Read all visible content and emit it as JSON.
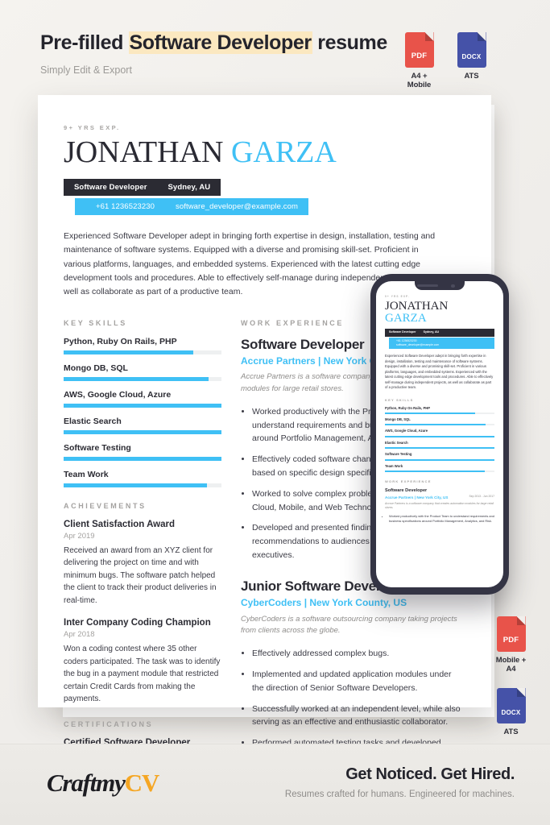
{
  "header": {
    "title_pre": "Pre-filled ",
    "title_hl": "Software Developer",
    "title_post": " resume",
    "subtitle": "Simply Edit & Export"
  },
  "badges_top": [
    {
      "icon": "pdf-file-icon",
      "type": "PDF",
      "label": "A4 + Mobile"
    },
    {
      "icon": "docx-file-icon",
      "type": "DOCX",
      "label": "ATS"
    }
  ],
  "badges_right": [
    {
      "icon": "pdf-file-icon",
      "type": "PDF",
      "label": "Mobile + A4"
    },
    {
      "icon": "docx-file-icon",
      "type": "DOCX",
      "label": "ATS"
    }
  ],
  "resume": {
    "years_exp": "9+ YRS EXP.",
    "first_name": "JONATHAN",
    "last_name": "GARZA",
    "role": "Software Developer",
    "location": "Sydney, AU",
    "phone": "+61 1236523230",
    "email": "software_developer@example.com",
    "summary": "Experienced Software Developer adept in bringing forth expertise in design, installation, testing and maintenance of software systems. Equipped with a diverse and promising skill-set. Proficient in various platforms, languages, and embedded systems. Experienced with the latest cutting edge development tools and procedures. Able to effectively self-manage during independent projects, as well as collaborate as part of a productive team.",
    "skills_heading": "KEY SKILLS",
    "skills": [
      {
        "name": "Python, Ruby On Rails, PHP",
        "level": 82
      },
      {
        "name": "Mongo DB, SQL",
        "level": 92
      },
      {
        "name": "AWS, Google Cloud, Azure",
        "level": 100
      },
      {
        "name": "Elastic Search",
        "level": 100
      },
      {
        "name": "Software Testing",
        "level": 100
      },
      {
        "name": "Team Work",
        "level": 91
      }
    ],
    "achievements_heading": "ACHIEVEMENTS",
    "achievements": [
      {
        "title": "Client Satisfaction Award",
        "date": "Apr 2019",
        "text": "Received an award from an XYZ client for delivering the project on time and with minimum bugs. The software patch helped the client to track their product deliveries in real-time."
      },
      {
        "title": "Inter Company Coding Champion",
        "date": "Apr 2018",
        "text": "Won a coding contest where 35 other coders participated. The task was to identify the bug in a payment module that restricted certain Credit Cards from making the payments."
      }
    ],
    "certifications_heading": "CERTIFICATIONS",
    "certifications": [
      {
        "title": "Certified Software Developer"
      }
    ],
    "experience_heading": "WORK EXPERIENCE",
    "jobs": [
      {
        "title": "Software Developer",
        "org": "Accrue Partners | New York City, US",
        "date": "Sep 2013 - Jun 2017",
        "desc": "Accrue Partners is a software company that creates automation modules for large retail stores.",
        "bullets": [
          "Worked productively with the Product Team to understand requirements and business specifications around Portfolio Management, Analytics, and Risk.",
          "Effectively coded software changes and modifications based on specific design specifications.",
          "Worked to solve complex problems with Data Science, Cloud, Mobile, and Web Technologies.",
          "Developed and presented findings and recommendations to audiences including senior executives."
        ]
      },
      {
        "title": "Junior Software Developer",
        "org": "CyberCoders | New York County, US",
        "desc": "CyberCoders is a software outsourcing company taking projects from clients across the globe.",
        "bullets": [
          "Effectively addressed complex bugs.",
          "Implemented and updated application modules under the direction of Senior Software Developers.",
          "Successfully worked at an independent level, while also serving as an effective and enthusiastic collaborator.",
          "Performed automated testing tasks and developed complex features routinely."
        ]
      }
    ]
  },
  "footer": {
    "logo_main": "Craftmy",
    "logo_accent": "CV",
    "tagline": "Get Noticed. Get Hired.",
    "subtagline": "Resumes crafted for humans. Engineered for machines."
  },
  "colors": {
    "accent_blue": "#3fc0f5",
    "dark": "#2b2b33",
    "highlight": "#fbe8c0",
    "pdf_red": "#e8534a",
    "docx_blue": "#4552a8",
    "logo_orange": "#f5a623"
  }
}
